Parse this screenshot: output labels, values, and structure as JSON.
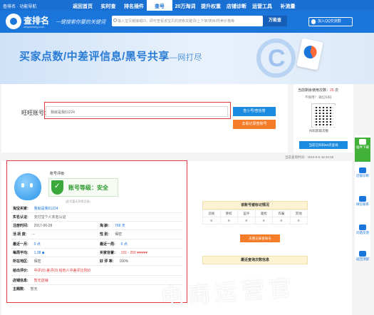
{
  "topbar": {
    "site_label": "查排名 · 功能导航",
    "nav": [
      "返回首页",
      "实时查",
      "排名插件",
      "查号",
      "20万淘词",
      "提升权重",
      "店铺诊断",
      "运营工具",
      "补流量"
    ],
    "active_index": 3
  },
  "header": {
    "logo": "查排名",
    "logo_sub": "chapaiming.com",
    "slogan": "一键搜索你要的关键词",
    "search_placeholder": "输入宝贝链接或ID，即可查看该宝贝的搜索关键词/上下架/类目/所卖价格等",
    "search_button": "万能查",
    "qq_button": "加入QQ交流群"
  },
  "banner": {
    "title": "买家点数/中差评信息/黑号共享",
    "tail": "—网打尽"
  },
  "search_panel": {
    "label": "旺旺账号：",
    "input_value": "我就是我61224",
    "btn_query": "查小号/查信誉",
    "btn_record": "去看记录查账号"
  },
  "sidebox": {
    "remaining_prefix": "当前剩余使用次数：",
    "remaining_count": "25",
    "remaining_suffix": " 次",
    "hint": "不够用？ 微信扫码",
    "scan_text": "扫码获取次数",
    "btn": "当前已扫码50次查询"
  },
  "timestamp": "当前查询时间：2019-8-5 16:40:58",
  "result": {
    "level_caption": "账号评级:",
    "level_text": "账号等级：安全",
    "level_note": "(此号暂无异常记录)",
    "rows": [
      {
        "k": "淘宝买家:",
        "v": "我就是我61224",
        "cls": "blue"
      },
      {
        "k": "实名认证:",
        "v": "支付宝个人实名认证",
        "cls": ""
      },
      {
        "k": "注册时间:",
        "v": "2017-06-28",
        "cls": ""
      },
      {
        "k": "活 跃 度:",
        "v": "--",
        "cls": ""
      },
      {
        "k": "最近一月:",
        "v": "0 点",
        "cls": "blue"
      },
      {
        "k": "每周平均:",
        "v": "1.38 ◆",
        "cls": "blue"
      },
      {
        "k": "所在地区:",
        "v": "保密",
        "cls": ""
      },
      {
        "k": "给出评价:",
        "v": "中评(0)  差评(0)  给他人中差评比例(0",
        "cls": "red"
      },
      {
        "k": "店铺信息:",
        "v": "暂无店铺",
        "cls": "red"
      },
      {
        "k": "主题数:",
        "v": "暂无",
        "cls": ""
      }
    ],
    "rows2": [
      {
        "k": "淘 龄:",
        "v": "768 天",
        "cls": "blue"
      },
      {
        "k": "性 别:",
        "v": "保密",
        "cls": ""
      },
      {
        "k": "最近一周:",
        "v": "0 点",
        "cls": "blue"
      },
      {
        "k": "买家信誉:",
        "v": "151 - 250 ♥♥♥♥♥",
        "cls": "red"
      },
      {
        "k": "好 评 率:",
        "v": "100%",
        "cls": ""
      }
    ]
  },
  "records": {
    "title": "该账号被标记情况",
    "cols": [
      "违规",
      "降权",
      "差评",
      "骚扰",
      "诈骗",
      "其他"
    ],
    "vals": [
      "0",
      "0",
      "0",
      "0",
      "0",
      "0"
    ],
    "btn": "去看记录查账号",
    "recent_title": "最近查询次数信息"
  },
  "float_bar": [
    {
      "label": "插件下载",
      "green": true
    },
    {
      "label": "店铺诊断",
      "green": false
    },
    {
      "label": "微信联系",
      "green": false
    },
    {
      "label": "问题反馈",
      "green": false
    },
    {
      "label": "返回顶部",
      "green": false
    }
  ],
  "watermark": "电商运营官"
}
